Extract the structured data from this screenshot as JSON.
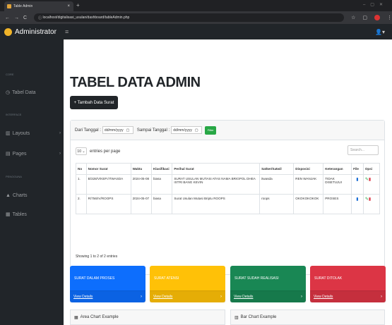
{
  "browser": {
    "tab_title": "Table Admin",
    "tab_close": "×",
    "new_tab": "+",
    "url": "localhost/digitalisasi_usulan/dashboard/tableAdmin.php",
    "back": "←",
    "forward": "→",
    "reload": "C"
  },
  "topnav": {
    "brand": "Administrator",
    "menu_icon": "≡",
    "user_icon": "👤▾"
  },
  "sidebar": {
    "heading_core": "CORE",
    "dashboard": "Tabel Data",
    "heading_interface": "INTERFACE",
    "layouts": "Layouts",
    "pages": "Pages",
    "heading_addons": "PENGGUNA",
    "charts": "Charts",
    "tables": "Tables"
  },
  "main": {
    "title": "TABEL DATA ADMIN",
    "add_button": "+ Tambah Data Surat",
    "filter": {
      "from_label": "Dari Tanggal :",
      "from_value": "dd/mm/yyyy",
      "to_label": "Sampai Tanggal :",
      "to_value": "dd/mm/yyyy",
      "button": "Filter"
    },
    "entries": {
      "value": "10",
      "label": "entries per page"
    },
    "search_placeholder": "Search...",
    "table": {
      "headers": [
        "No",
        "Nomor Surat",
        "Waktu",
        "Klasifikasi",
        "Perihal Surat",
        "Satker/Satwil",
        "Disposisi",
        "Keterangan",
        "File",
        "Opsi"
      ],
      "rows": [
        {
          "no": "1.",
          "nomor": "B/328/V/KEP./ITWASDA",
          "waktu": "2024-05-08",
          "klas": "biasa",
          "perihal": "SURAT USULAN MUTASI ATAS NAMA BRIGPOL DHEA ISTRI BANG KEVIN",
          "satker": "itwasda",
          "disposisi": "REN WANJAK",
          "ket": "TIDAK DISETUJUI"
        },
        {
          "no": "2.",
          "nomor": "R/756/IV/ROOPS",
          "waktu": "2024-05-07",
          "klas": "biasa",
          "perihal": "Surat Usulan Mutasi Briptu ROOPS",
          "satker": "roops",
          "disposisi": "OKOKOKOKOK",
          "ket": "PROSES"
        }
      ]
    },
    "info": "Showing 1 to 2 of 2 entries",
    "cards": [
      {
        "title": "SURAT DALAM PROSES",
        "link": "View Details",
        "color": "#0d6efd"
      },
      {
        "title": "SURAT ATENSI",
        "link": "View Details",
        "color": "#ffc107"
      },
      {
        "title": "SURAT SUDAH REALISASI",
        "link": "View Details",
        "color": "#198754"
      },
      {
        "title": "SURAT DITOLAK",
        "link": "View Details",
        "color": "#dc3545"
      }
    ],
    "chart_titles": {
      "area": "Area Chart Example",
      "bar": "Bar Chart Example"
    }
  }
}
